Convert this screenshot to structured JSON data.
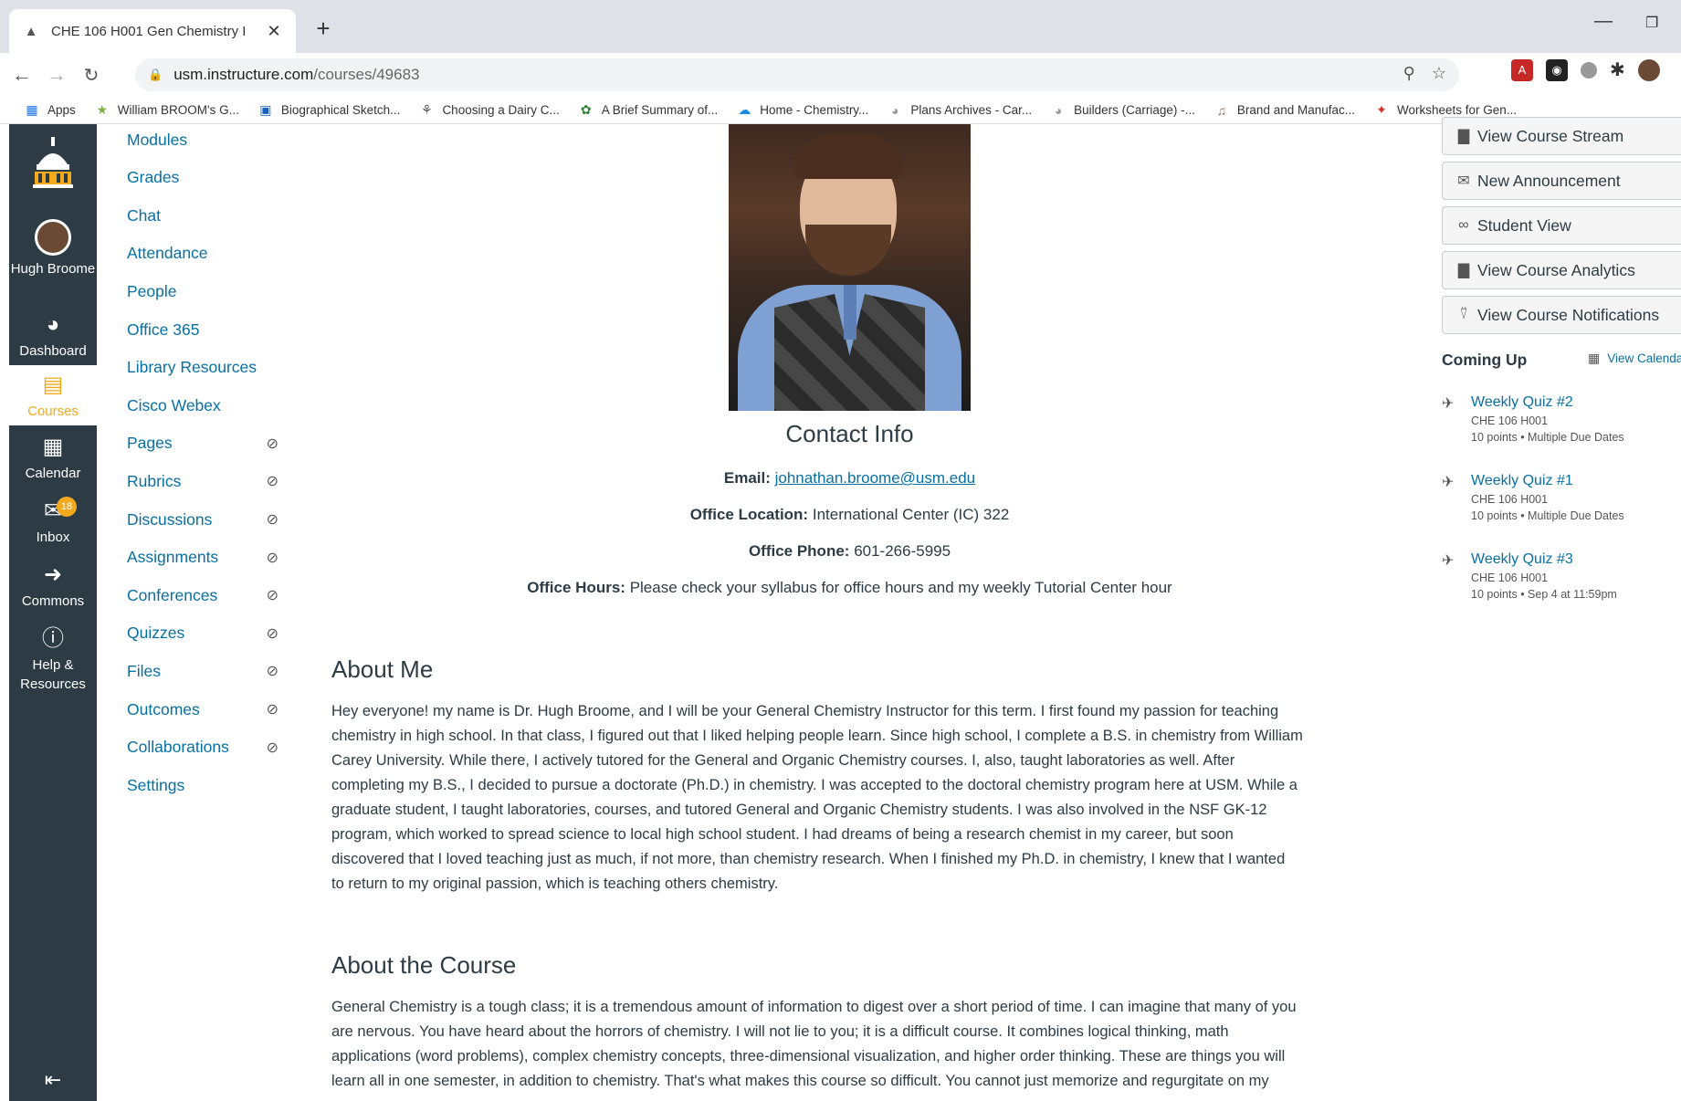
{
  "browser": {
    "tab_title": "CHE 106 H001 Gen Chemistry I",
    "url_host": "usm.instructure.com",
    "url_path": "/courses/49683",
    "bookmarks": [
      "Apps",
      "William BROOM's G...",
      "Biographical Sketch...",
      "Choosing a Dairy C...",
      "A Brief Summary of...",
      "Home - Chemistry...",
      "Plans Archives - Car...",
      "Builders (Carriage) -...",
      "Brand and Manufac...",
      "Worksheets for Gen..."
    ]
  },
  "global_nav": {
    "user": "Hugh Broome",
    "dashboard": "Dashboard",
    "courses": "Courses",
    "calendar": "Calendar",
    "inbox": "Inbox",
    "inbox_count": "18",
    "commons": "Commons",
    "help": "Help & Resources"
  },
  "course_nav": {
    "items": [
      {
        "label": "Modules",
        "hidden": false
      },
      {
        "label": "Grades",
        "hidden": false
      },
      {
        "label": "Chat",
        "hidden": false
      },
      {
        "label": "Attendance",
        "hidden": false
      },
      {
        "label": "People",
        "hidden": false
      },
      {
        "label": "Office 365",
        "hidden": false
      },
      {
        "label": "Library Resources",
        "hidden": false
      },
      {
        "label": "Cisco Webex",
        "hidden": false
      },
      {
        "label": "Pages",
        "hidden": true
      },
      {
        "label": "Rubrics",
        "hidden": true
      },
      {
        "label": "Discussions",
        "hidden": true
      },
      {
        "label": "Assignments",
        "hidden": true
      },
      {
        "label": "Conferences",
        "hidden": true
      },
      {
        "label": "Quizzes",
        "hidden": true
      },
      {
        "label": "Files",
        "hidden": true
      },
      {
        "label": "Outcomes",
        "hidden": true
      },
      {
        "label": "Collaborations",
        "hidden": true
      },
      {
        "label": "Settings",
        "hidden": false
      }
    ]
  },
  "main": {
    "contact_title": "Contact Info",
    "email_label": "Email:",
    "email": "johnathan.broome@usm.edu",
    "office_location_label": "Office Location:",
    "office_location": "International Center (IC) 322",
    "office_phone_label": "Office Phone:",
    "office_phone": "601-266-5995",
    "office_hours_label": "Office Hours:",
    "office_hours": "Please check your syllabus for office hours and my weekly Tutorial Center hour",
    "about_me_title": "About Me",
    "about_me_lines": [
      "Hey everyone! my name is Dr. Hugh Broome, and I will be your General Chemistry Instructor for this term. I first found my passion for teaching",
      "chemistry in high school. In that class, I figured out that I liked helping people learn. Since high school, I complete a B.S. in chemistry from William",
      "Carey University. While there, I actively tutored for the General and Organic Chemistry courses. I, also, taught laboratories as well. After",
      "completing my B.S., I decided to pursue a doctorate (Ph.D.) in chemistry. I was accepted to the doctoral chemistry program here at USM. While a",
      "graduate student, I taught laboratories, courses, and tutored General and Organic Chemistry students. I was also involved in the NSF GK-12",
      "program, which worked to spread science to local high school student. I had dreams of being a research chemist in my career, but soon",
      "discovered that I loved teaching just as much, if not more, than chemistry research. When I finished my Ph.D. in chemistry, I knew that I wanted",
      "to return to my original passion, which is teaching others chemistry."
    ],
    "about_course_title": "About the Course",
    "about_course_lines": [
      "General Chemistry is a tough class; it is a tremendous amount of information to digest over a short period of time. I can imagine that many of you",
      "are nervous. You have heard about the horrors of chemistry. I will not lie to you; it is a difficult course. It combines logical thinking, math",
      "applications (word problems), complex chemistry concepts, three-dimensional visualization, and higher order thinking. These are things you will",
      "learn all in one semester, in addition to chemistry. That's what makes this course so difficult. You cannot just memorize and regurgitate on my"
    ]
  },
  "sidebar": {
    "buttons": [
      {
        "label": "View Course Stream",
        "icon": "chart-icon"
      },
      {
        "label": "New Announcement",
        "icon": "megaphone-icon"
      },
      {
        "label": "Student View",
        "icon": "glasses-icon"
      },
      {
        "label": "View Course Analytics",
        "icon": "chart-icon"
      },
      {
        "label": "View Course Notifications",
        "icon": "bell-icon"
      }
    ],
    "coming_up": "Coming Up",
    "view_calendar": "View Calendar",
    "todos": [
      {
        "title": "Weekly Quiz #2",
        "course": "CHE 106 H001",
        "meta": "10 points • Multiple Due Dates"
      },
      {
        "title": "Weekly Quiz #1",
        "course": "CHE 106 H001",
        "meta": "10 points • Multiple Due Dates"
      },
      {
        "title": "Weekly Quiz #3",
        "course": "CHE 106 H001",
        "meta": "10 points • Sep 4 at 11:59pm"
      }
    ]
  }
}
